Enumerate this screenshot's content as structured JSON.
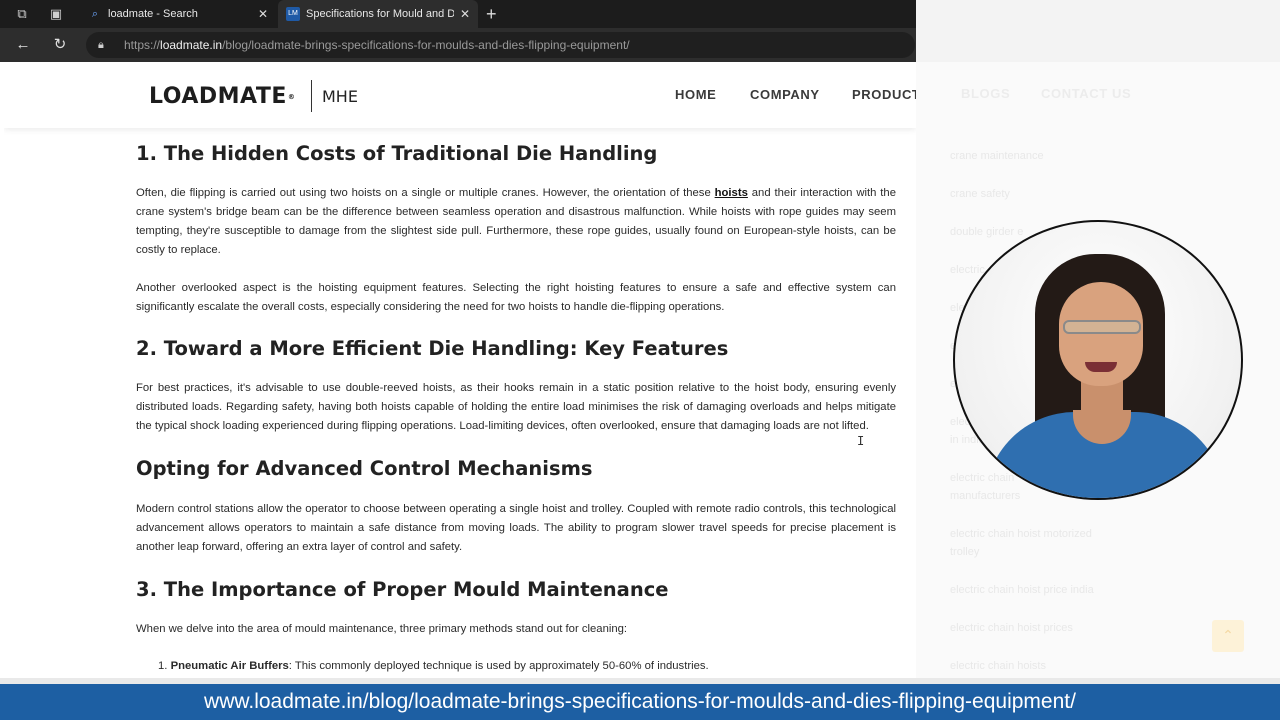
{
  "browser": {
    "tabs": [
      {
        "title": "loadmate - Search",
        "favicon": "search-icon",
        "active": false
      },
      {
        "title": "Specifications for Mould and Dies",
        "favicon": "loadmate-favicon",
        "active": true
      }
    ],
    "url_prefix": "https://",
    "url_domain": "loadmate.in",
    "url_path": "/blog/loadmate-brings-specifications-for-moulds-and-dies-flipping-equipment/"
  },
  "site": {
    "logo": "LOADMATE",
    "logo_mark": "®",
    "logo_suffix": "MHE",
    "menu": [
      "HOME",
      "COMPANY",
      "PRODUCTS",
      "BLOGS",
      "CONTACT US"
    ]
  },
  "article": {
    "h1": "1. The Hidden Costs of Traditional Die Handling",
    "p1_a": "Often, die flipping is carried out using two hoists on a single or multiple cranes. However, the orientation of these ",
    "p1_link": "hoists",
    "p1_b": " and their interaction with the crane system's bridge beam can be the difference between seamless operation and disastrous malfunction. While hoists with rope guides may seem tempting, they're susceptible to damage from the slightest side pull. Furthermore, these rope guides, usually found on European-style hoists, can be costly to replace.",
    "p2": "Another overlooked aspect is the hoisting equipment features. Selecting the right hoisting features to ensure a safe and effective system can significantly escalate the overall costs, especially considering the need for two hoists to handle die-flipping operations.",
    "h2": "2. Toward a More Efficient Die Handling: Key Features",
    "p3": "For best practices, it's advisable to use double-reeved hoists, as their hooks remain in a static position relative to the hoist body, ensuring evenly distributed loads. Regarding safety, having both hoists capable of holding the entire load minimises the risk of damaging overloads and helps mitigate the typical shock loading experienced during flipping operations. Load-limiting devices, often overlooked, ensure that damaging loads are not lifted.",
    "h3": "Opting for Advanced Control Mechanisms",
    "p4": "Modern control stations allow the operator to choose between operating a single hoist and trolley. Coupled with remote radio controls, this technological advancement allows operators to maintain a safe distance from moving loads. The ability to program slower travel speeds for precise placement is another leap forward, offering an extra layer of control and safety.",
    "h4": "3. The Importance of Proper Mould Maintenance",
    "p5": "When we delve into the area of mould maintenance, three primary methods stand out for cleaning:",
    "li1_num": "1.",
    "li1_bold": "Pneumatic Air Buffers",
    "li1_text": ": This commonly deployed technique is used by approximately 50-60% of industries."
  },
  "sidebar_faded": [
    "crane maintenance",
    "crane safety",
    "double girder e",
    "electric chain hoist",
    "electric chain",
    "electric chain",
    "electric",
    "electric chain",
    "in india",
    "electric chain",
    "manufacturers",
    "electric chain hoist motorized",
    "trolley",
    "electric chain hoist price india",
    "electric chain hoist prices",
    "electric chain hoists"
  ],
  "caption": "www.loadmate.in/blog/loadmate-brings-specifications-for-moulds-and-dies-flipping-equipment/",
  "colors": {
    "caption_bg": "#1d5fa3",
    "chrome_bg": "#1c1c1c"
  }
}
